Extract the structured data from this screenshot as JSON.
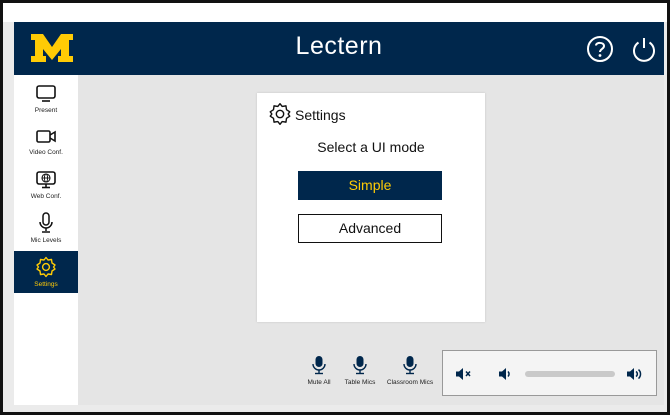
{
  "header": {
    "title": "Lectern",
    "logo": "M",
    "help_icon": "help-icon",
    "power_icon": "power-icon"
  },
  "sidebar": {
    "items": [
      {
        "label": "Present",
        "icon": "monitor-icon"
      },
      {
        "label": "Video Conf.",
        "icon": "video-camera-icon"
      },
      {
        "label": "Web Conf.",
        "icon": "globe-monitor-icon"
      },
      {
        "label": "Mic Levels",
        "icon": "microphone-icon"
      },
      {
        "label": "Settings",
        "icon": "gear-icon",
        "active": true
      }
    ]
  },
  "settings": {
    "title": "Settings",
    "prompt": "Select a UI mode",
    "options": [
      {
        "label": "Simple",
        "selected": true
      },
      {
        "label": "Advanced",
        "selected": false
      }
    ]
  },
  "mics": {
    "buttons": [
      {
        "label": "Mute All"
      },
      {
        "label": "Table Mics"
      },
      {
        "label": "Classroom Mics"
      }
    ]
  },
  "volume": {
    "mute_icon": "volume-mute-icon",
    "down_icon": "volume-down-icon",
    "up_icon": "volume-up-icon",
    "level": 0
  },
  "colors": {
    "brand_blue": "#00274c",
    "maize": "#ffcb05"
  }
}
